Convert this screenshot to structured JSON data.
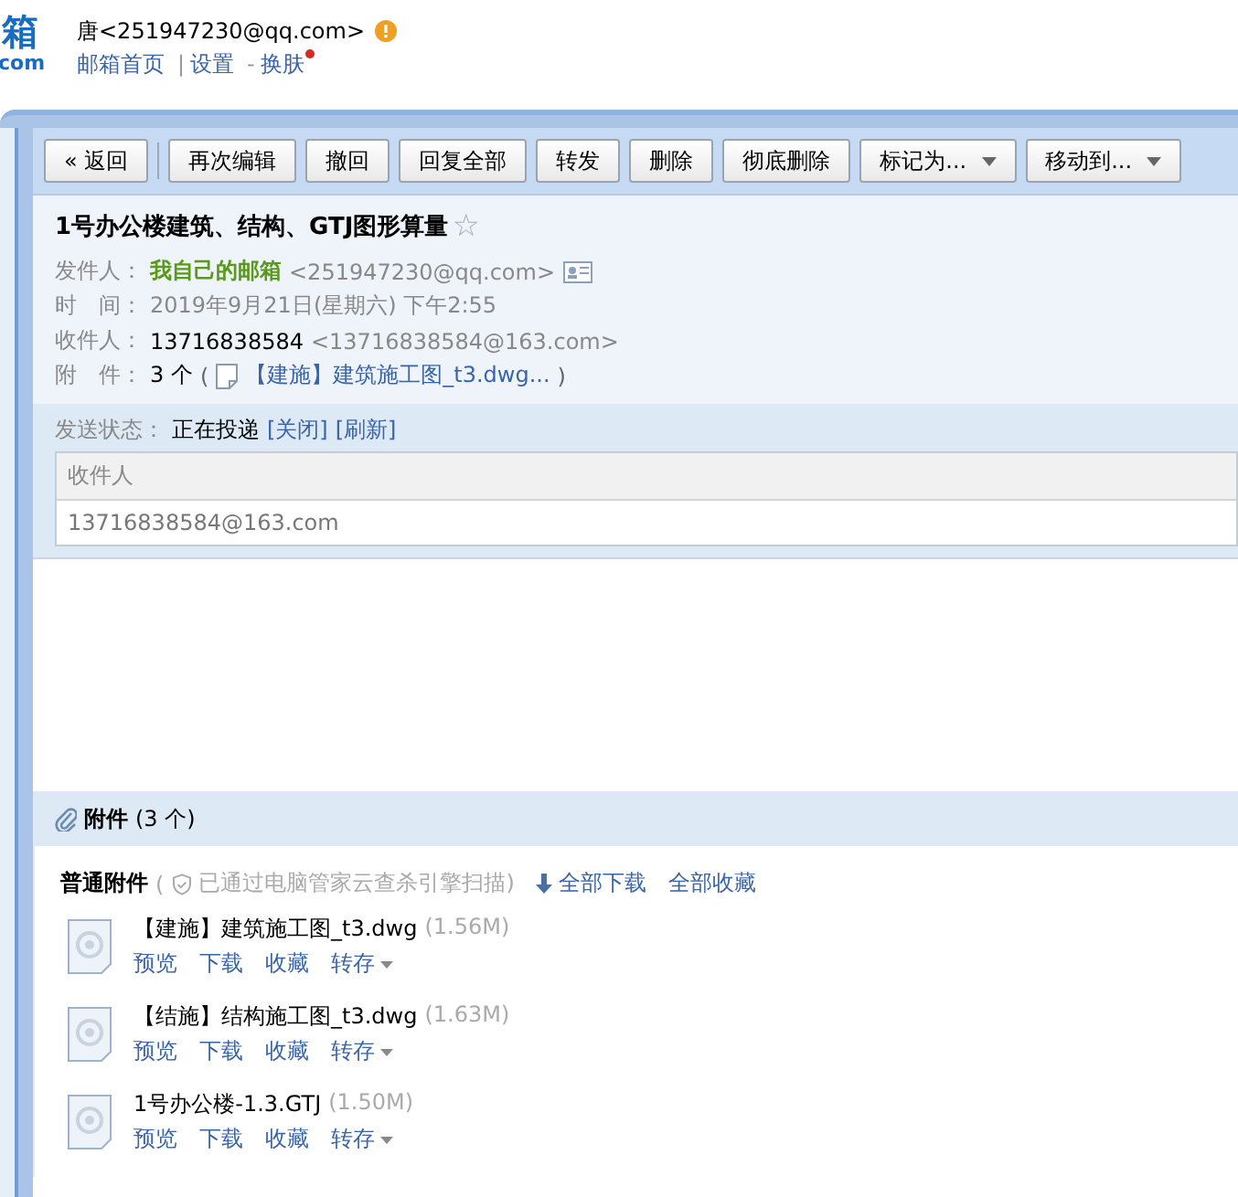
{
  "logo": {
    "title": "箱",
    "domain": "com"
  },
  "account": {
    "name": "唐<251947230@qq.com>",
    "warning": true,
    "nav": [
      {
        "kind": "link",
        "label": "邮箱首页"
      },
      {
        "kind": "sep",
        "label": "|"
      },
      {
        "kind": "link",
        "label": "设置"
      },
      {
        "kind": "sep",
        "label": "-"
      },
      {
        "kind": "link",
        "label": "换肤",
        "new": true
      }
    ]
  },
  "toolbar": [
    {
      "kind": "button",
      "label": "« 返回"
    },
    {
      "kind": "divider"
    },
    {
      "kind": "button",
      "label": "再次编辑"
    },
    {
      "kind": "button",
      "label": "撤回"
    },
    {
      "kind": "button",
      "label": "回复全部"
    },
    {
      "kind": "button",
      "label": "转发"
    },
    {
      "kind": "button",
      "label": "删除"
    },
    {
      "kind": "button",
      "label": "彻底删除"
    },
    {
      "kind": "dropdown",
      "label": "标记为..."
    },
    {
      "kind": "dropdown",
      "label": "移动到..."
    }
  ],
  "subject": {
    "text": "1号办公楼建筑、结构、GTJ图形算量",
    "star": "☆",
    "starred": false
  },
  "fields": [
    {
      "kind": "from",
      "label": "发件人：",
      "name": "我自己的邮箱",
      "address": "<251947230@qq.com>"
    },
    {
      "kind": "plain",
      "label": "时　间：",
      "value": "2019年9月21日(星期六) 下午2:55"
    },
    {
      "kind": "to",
      "label": "收件人：",
      "name": "13716838584",
      "address": "<13716838584@163.com>"
    },
    {
      "kind": "attach",
      "label": "附　件：",
      "count": "3 个",
      "open": "(",
      "link": "【建施】建筑施工图_t3.dwg...",
      "close": ")"
    }
  ],
  "status": {
    "label": "发送状态：",
    "value": "正在投递",
    "actions": [
      "[关闭]",
      "[刷新]"
    ],
    "table": {
      "column": "收件人",
      "rows": [
        "13716838584@163.com"
      ]
    }
  },
  "attachments": {
    "title": "附件",
    "count": "(3 个)",
    "group": "普通附件",
    "scan_open": "(",
    "scan_text": "已通过电脑管家云查杀引擎扫描)",
    "actions": [
      {
        "kind": "download",
        "label": "全部下载"
      },
      {
        "kind": "plain",
        "label": "全部收藏"
      }
    ],
    "files": [
      {
        "name": "【建施】建筑施工图_t3.dwg",
        "size": "(1.56M)",
        "actions": [
          {
            "label": "预览",
            "menu": false
          },
          {
            "label": "下载",
            "menu": false
          },
          {
            "label": "收藏",
            "menu": false
          },
          {
            "label": "转存",
            "menu": true
          }
        ]
      },
      {
        "name": "【结施】结构施工图_t3.dwg",
        "size": "(1.63M)",
        "actions": [
          {
            "label": "预览",
            "menu": false
          },
          {
            "label": "下载",
            "menu": false
          },
          {
            "label": "收藏",
            "menu": false
          },
          {
            "label": "转存",
            "menu": true
          }
        ]
      },
      {
        "name": "1号办公楼-1.3.GTJ",
        "size": "(1.50M)",
        "actions": [
          {
            "label": "预览",
            "menu": false
          },
          {
            "label": "下载",
            "menu": false
          },
          {
            "label": "收藏",
            "menu": false
          },
          {
            "label": "转存",
            "menu": true
          }
        ]
      }
    ]
  }
}
